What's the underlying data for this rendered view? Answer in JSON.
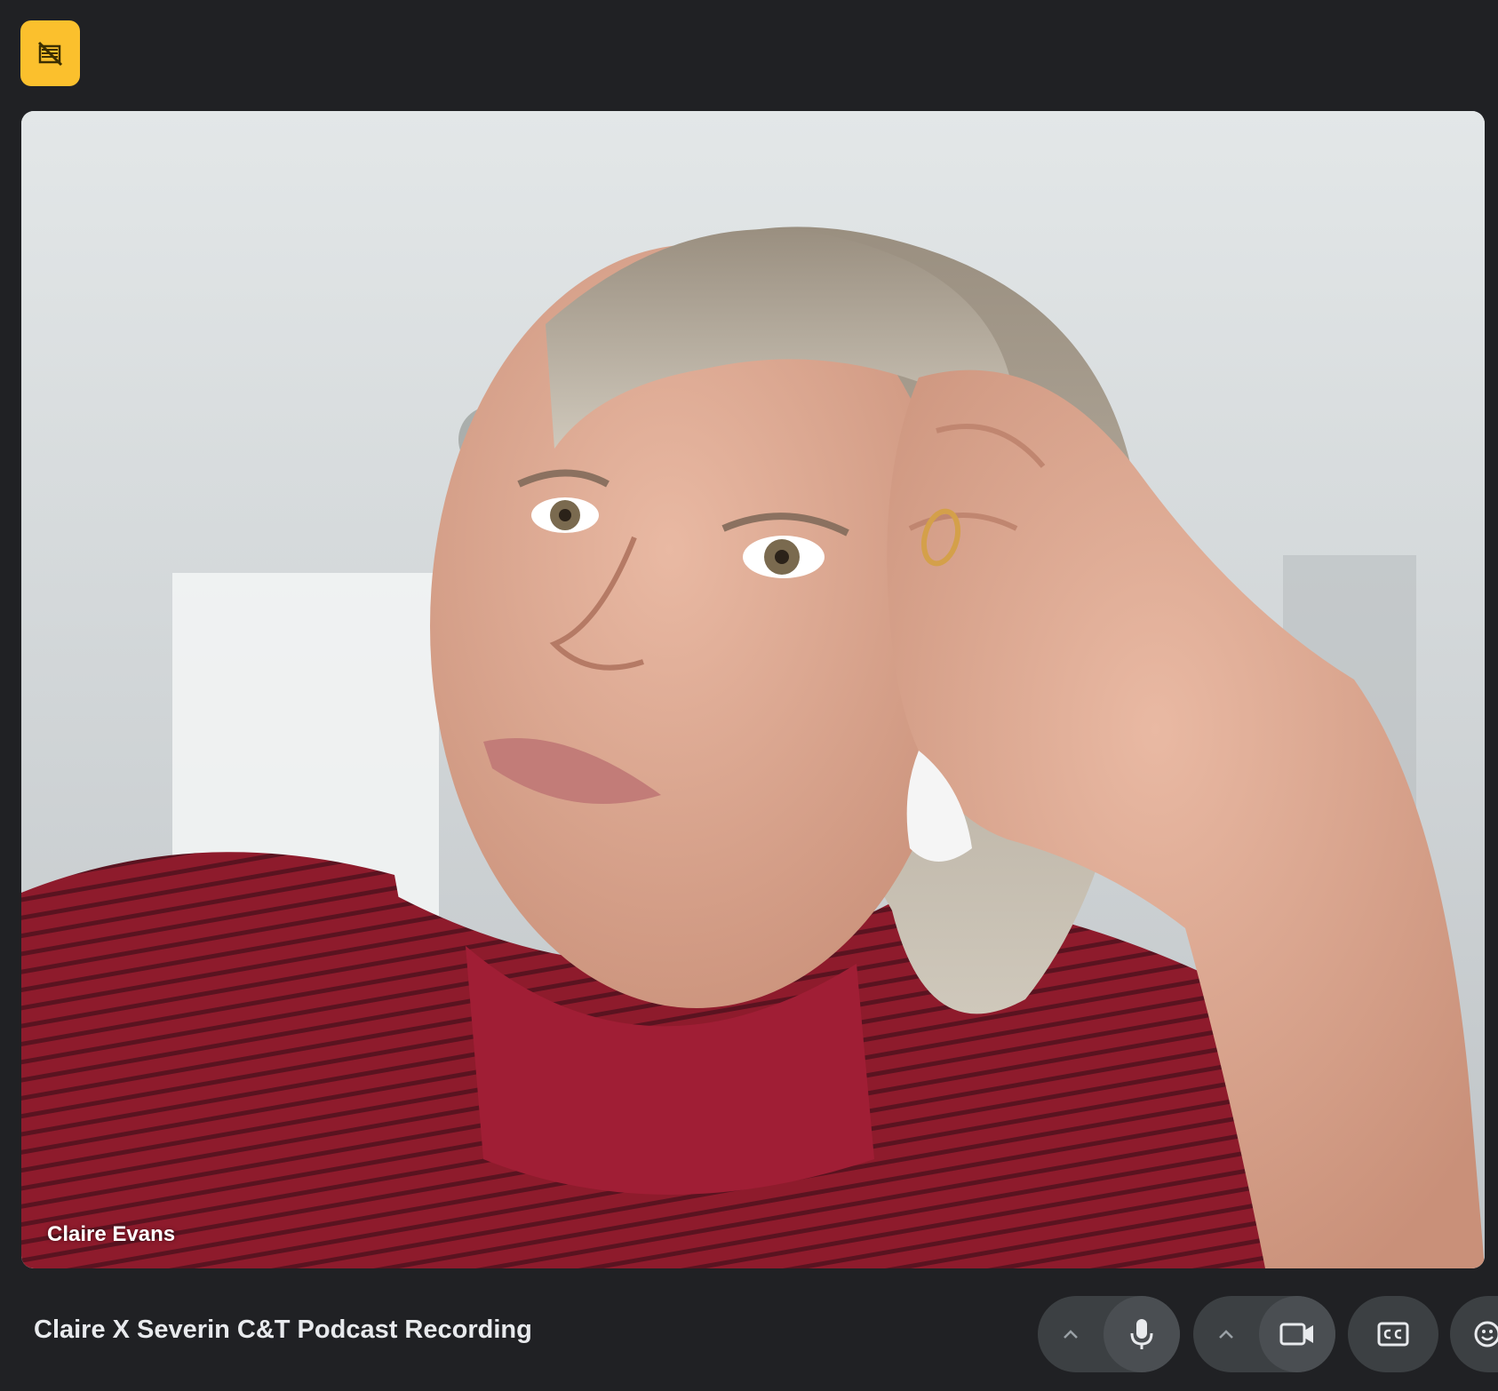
{
  "participant": {
    "name": "Claire Evans"
  },
  "meeting": {
    "title": "Claire X Severin C&T Podcast Recording"
  },
  "colors": {
    "background": "#202124",
    "badge": "#fbc02d",
    "control": "#3c4043"
  },
  "icons": {
    "badge": "recording-badge-icon",
    "mic": "microphone-icon",
    "camera": "camera-icon",
    "captions": "closed-captions-icon",
    "emoji": "emoji-icon",
    "chevron": "chevron-up-icon"
  }
}
